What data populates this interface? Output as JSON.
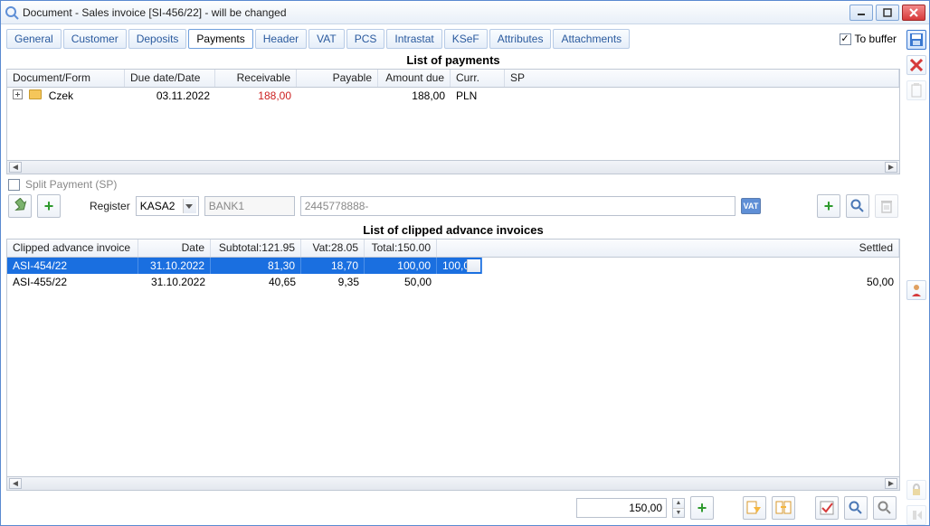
{
  "window": {
    "title": "Document - Sales invoice [SI-456/22]  - will be changed"
  },
  "tabs": [
    "General",
    "Customer",
    "Deposits",
    "Payments",
    "Header",
    "VAT",
    "PCS",
    "Intrastat",
    "KSeF",
    "Attributes",
    "Attachments"
  ],
  "active_tab_index": 3,
  "tobuffer": {
    "label": "To buffer",
    "checked": true
  },
  "payments": {
    "title": "List of payments",
    "headers": {
      "doc": "Document/Form",
      "due": "Due date/Date",
      "recv": "Receivable",
      "pay": "Payable",
      "amt": "Amount due",
      "curr": "Curr.",
      "sp": "SP"
    },
    "row": {
      "name": "Czek",
      "due": "03.11.2022",
      "recv": "188,00",
      "pay": "",
      "amt": "188,00",
      "curr": "PLN",
      "sp": ""
    }
  },
  "split": {
    "label": "Split Payment (SP)",
    "checked": false
  },
  "register": {
    "label": "Register",
    "value": "KASA2",
    "bank": "BANK1",
    "account": "2445778888-",
    "vat_label": "VAT"
  },
  "clipped": {
    "title": "List of clipped advance invoices",
    "headers": {
      "inv": "Clipped advance invoice",
      "date": "Date",
      "sub": "Subtotal:",
      "subv": "121.95",
      "vat": "Vat:",
      "vatv": "28.05",
      "tot": "Total:",
      "totv": "150.00",
      "settled": "Settled"
    },
    "rows": [
      {
        "inv": "ASI-454/22",
        "date": "31.10.2022",
        "sub": "81,30",
        "vat": "18,70",
        "tot": "100,00",
        "settled": "100,00"
      },
      {
        "inv": "ASI-455/22",
        "date": "31.10.2022",
        "sub": "40,65",
        "vat": "9,35",
        "tot": "50,00",
        "settled": "50,00"
      }
    ]
  },
  "bottom": {
    "amount": "150,00"
  }
}
